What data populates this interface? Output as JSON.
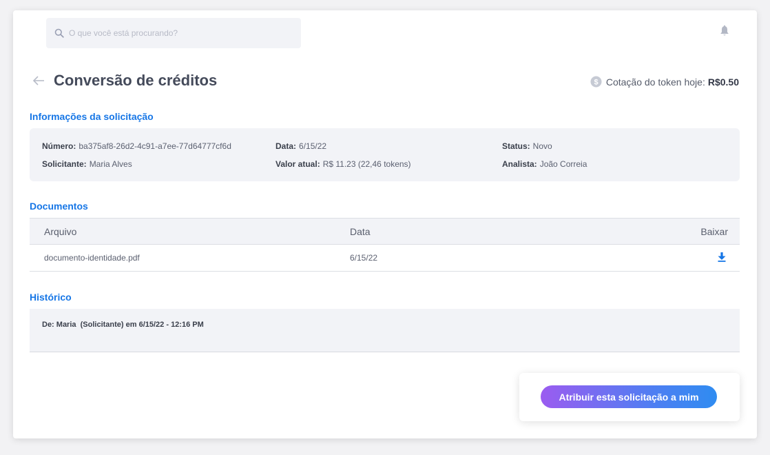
{
  "header": {
    "search_placeholder": "O que você está procurando?",
    "notifications_icon": "bell-icon"
  },
  "page": {
    "back_icon": "arrow-left-icon",
    "title": "Conversão de créditos",
    "token_quote": {
      "icon": "dollar-coin-icon",
      "label": "Cotação do token hoje:",
      "value": "R$0.50"
    }
  },
  "request_info": {
    "section_title": "Informações da solicitação",
    "fields": {
      "numero": {
        "label": "Número:",
        "value": "ba375af8-26d2-4c91-a7ee-77d64777cf6d"
      },
      "data": {
        "label": "Data:",
        "value": "6/15/22"
      },
      "status": {
        "label": "Status:",
        "value": "Novo"
      },
      "solicitante": {
        "label": "Solicitante:",
        "value": "Maria Alves"
      },
      "valor_atual": {
        "label": "Valor atual:",
        "value": "R$ 11.23 (22,46 tokens)"
      },
      "analista": {
        "label": "Analista:",
        "value": "João Correia"
      }
    }
  },
  "documents": {
    "section_title": "Documentos",
    "columns": {
      "file": "Arquivo",
      "date": "Data",
      "download": "Baixar"
    },
    "rows": [
      {
        "file": "documento-identidade.pdf",
        "date": "6/15/22",
        "download_icon": "download-icon"
      }
    ]
  },
  "history": {
    "section_title": "Histórico",
    "entries": [
      {
        "text": "De: Maria  (Solicitante) em 6/15/22 - 12:16 PM"
      }
    ]
  },
  "actions": {
    "assign_label": "Atribuir esta solicitação a mim"
  },
  "colors": {
    "accent": "#1676e6",
    "button_gradient_start": "#9b5cf0",
    "button_gradient_end": "#2f8cf1",
    "panel_bg": "#f2f3f7"
  }
}
